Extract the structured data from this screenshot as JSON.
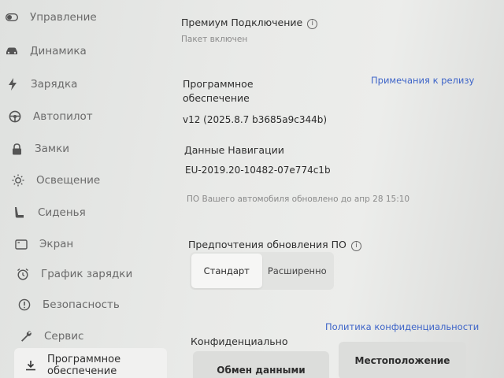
{
  "sidebar": {
    "items": [
      {
        "label": "Управление",
        "icon": "toggle-icon"
      },
      {
        "label": "Динамика",
        "icon": "car-icon"
      },
      {
        "label": "Зарядка",
        "icon": "bolt-icon"
      },
      {
        "label": "Автопилот",
        "icon": "steering-wheel-icon"
      },
      {
        "label": "Замки",
        "icon": "lock-icon"
      },
      {
        "label": "Освещение",
        "icon": "sun-icon"
      },
      {
        "label": "Сиденья",
        "icon": "seat-icon"
      },
      {
        "label": "Экран",
        "icon": "display-icon"
      },
      {
        "label": "График зарядки",
        "icon": "alarm-clock-icon"
      },
      {
        "label": "Безопасность",
        "icon": "alert-circle-icon"
      },
      {
        "label": "Сервис",
        "icon": "wrench-icon"
      },
      {
        "label": "Программное обеспечение",
        "icon": "download-icon"
      }
    ]
  },
  "premium": {
    "title": "Премиум Подключение",
    "status": "Пакет включен"
  },
  "software": {
    "title": "Программное обеспечение",
    "release_notes_link": "Примечания к релизу",
    "version": "v12 (2025.8.7 b3685a9c344b)"
  },
  "navigation": {
    "title": "Данные Навигации",
    "version": "EU-2019.20-10482-07e774c1b",
    "update_status": "ПО Вашего автомобиля обновлено до апр 28 15:10"
  },
  "update_prefs": {
    "title": "Предпочтения обновления ПО",
    "options": [
      "Стандарт",
      "Расширенно"
    ],
    "selected": "Стандарт"
  },
  "privacy": {
    "title": "Конфиденциально",
    "policy_link": "Политика конфиденциальности",
    "buttons": [
      "Обмен данными",
      "Местоположение"
    ]
  }
}
